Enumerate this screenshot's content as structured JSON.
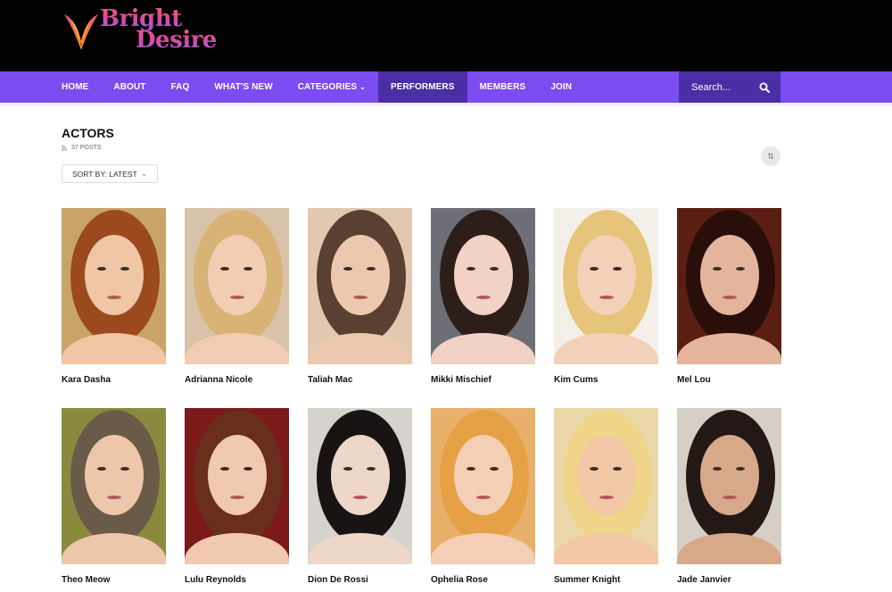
{
  "brand": {
    "line1": "Bright",
    "line2": "Desire"
  },
  "nav": {
    "items": [
      {
        "label": "HOME",
        "active": false
      },
      {
        "label": "ABOUT",
        "active": false
      },
      {
        "label": "FAQ",
        "active": false
      },
      {
        "label": "WHAT'S NEW",
        "active": false
      },
      {
        "label": "CATEGORIES",
        "active": false,
        "has_dropdown": true
      },
      {
        "label": "PERFORMERS",
        "active": true
      },
      {
        "label": "MEMBERS",
        "active": false
      },
      {
        "label": "JOIN",
        "active": false
      }
    ],
    "search_placeholder": "Search..."
  },
  "page": {
    "title": "ACTORS",
    "posts_count": "37 POSTS",
    "sort_label": "SORT BY: LATEST"
  },
  "performers": [
    {
      "name": "Kara Dasha",
      "colors": {
        "bg": "#c8a46a",
        "hair": "#9a4a1e",
        "skin": "#f0c6a4"
      }
    },
    {
      "name": "Adrianna Nicole",
      "colors": {
        "bg": "#d8c2aa",
        "hair": "#d9b275",
        "skin": "#f2cdb4"
      }
    },
    {
      "name": "Taliah Mac",
      "colors": {
        "bg": "#e2c8b0",
        "hair": "#5a4030",
        "skin": "#ecc9ae"
      }
    },
    {
      "name": "Mikki Mischief",
      "colors": {
        "bg": "#6e6e76",
        "hair": "#2d1e1a",
        "skin": "#f2d2c4"
      }
    },
    {
      "name": "Kim Cums",
      "colors": {
        "bg": "#f4efe8",
        "hair": "#e6c47a",
        "skin": "#f3d0b8"
      }
    },
    {
      "name": "Mel Lou",
      "colors": {
        "bg": "#5a1e12",
        "hair": "#2a0e0a",
        "skin": "#e4b59c"
      }
    },
    {
      "name": "Theo Meow",
      "colors": {
        "bg": "#8a8a3e",
        "hair": "#6a5a48",
        "skin": "#eec6aa"
      }
    },
    {
      "name": "Lulu Reynolds",
      "colors": {
        "bg": "#7a1a1a",
        "hair": "#6a2e1c",
        "skin": "#f0c9b0"
      }
    },
    {
      "name": "Dion De Rossi",
      "colors": {
        "bg": "#d6d2cc",
        "hair": "#181414",
        "skin": "#eed6c8"
      }
    },
    {
      "name": "Ophelia Rose",
      "colors": {
        "bg": "#e8b06a",
        "hair": "#e6a045",
        "skin": "#f4cfb6"
      }
    },
    {
      "name": "Summer Knight",
      "colors": {
        "bg": "#e9d7a8",
        "hair": "#f0d48a",
        "skin": "#f2c8a6"
      }
    },
    {
      "name": "Jade Janvier",
      "colors": {
        "bg": "#d6cfc6",
        "hair": "#231816",
        "skin": "#d8a88a"
      }
    }
  ]
}
